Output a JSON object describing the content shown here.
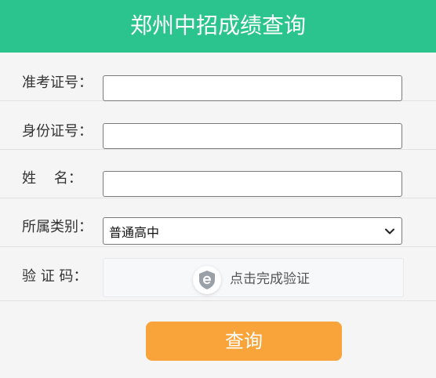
{
  "header": {
    "title": "郑州中招成绩查询"
  },
  "form": {
    "exam_id": {
      "label": "准考证号：",
      "value": ""
    },
    "id_card": {
      "label": "身份证号：",
      "value": ""
    },
    "name": {
      "label": "姓    名：",
      "value": ""
    },
    "category": {
      "label": "所属类别：",
      "selected": "普通高中"
    },
    "captcha": {
      "label": "验 证 码：",
      "prompt": "点击完成验证"
    }
  },
  "submit": {
    "label": "查询"
  },
  "colors": {
    "header_bg": "#2bc48f",
    "button_bg": "#f9a43a",
    "page_bg": "#f5f5f5"
  },
  "icons": {
    "captcha": "shield-e-icon",
    "select": "chevron-down-icon"
  }
}
